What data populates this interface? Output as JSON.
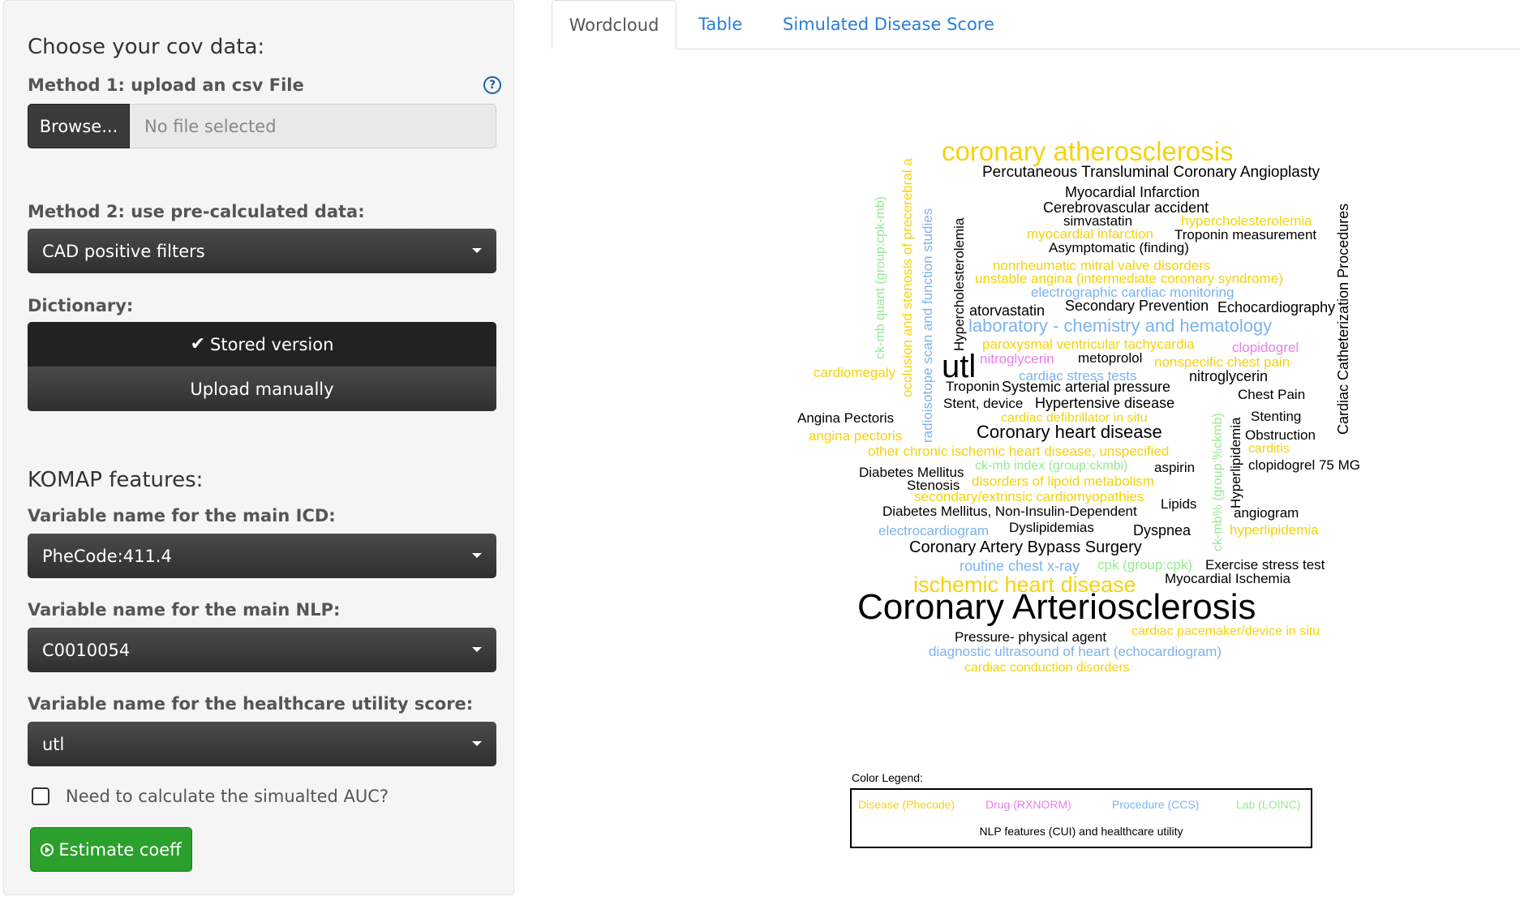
{
  "sidebar": {
    "heading": "Choose your cov data:",
    "method1_label": "Method 1: upload an csv File",
    "browse_label": "Browse...",
    "file_placeholder": "No file selected",
    "method2_label": "Method 2: use pre-calculated data:",
    "method2_value": "CAD positive filters",
    "dictionary_label": "Dictionary:",
    "dict_stored": "Stored version",
    "dict_manual": "Upload manually",
    "komap_heading": "KOMAP features:",
    "icd_label": "Variable name for the main ICD:",
    "icd_value": "PheCode:411.4",
    "nlp_label": "Variable name for the main NLP:",
    "nlp_value": "C0010054",
    "util_label": "Variable name for the healthcare utility score:",
    "util_value": "utl",
    "auc_label": "Need to calculate the simualted AUC?",
    "estimate_label": "Estimate coeff"
  },
  "tabs": [
    "Wordcloud",
    "Table",
    "Simulated Disease Score"
  ],
  "wordcloud": {
    "words": [
      "coronary atherosclerosis",
      "Percutaneous Transluminal Coronary Angioplasty",
      "Myocardial Infarction",
      "Cerebrovascular accident",
      "simvastatin",
      "hypercholesterolemia",
      "myocardial infarction",
      "Troponin measurement",
      "Asymptomatic (finding)",
      "nonrheumatic mitral valve disorders",
      "unstable angina (intermediate coronary syndrome)",
      "electrographic cardiac monitoring",
      "atorvastatin",
      "Secondary Prevention",
      "Echocardiography",
      "laboratory - chemistry and hematology",
      "paroxysmal ventricular tachycardia",
      "clopidogrel",
      "nitroglycerin",
      "metoprolol",
      "nonspecific chest pain",
      "utl",
      "cardiomegaly",
      "cardiac stress tests",
      "nitroglycerin",
      "Troponin",
      "Systemic arterial pressure",
      "Chest Pain",
      "Stent, device",
      "Hypertensive disease",
      "Stenting",
      "Angina Pectoris",
      "cardiac defibrillator in situ",
      "angina pectoris",
      "Coronary heart disease",
      "Obstruction",
      "other chronic ischemic heart disease, unspecified",
      "carditis",
      "Diabetes Mellitus",
      "ck-mb index (group:ckmbi)",
      "aspirin",
      "clopidogrel 75 MG",
      "Stenosis",
      "disorders of lipoid metabolism",
      "secondary/extrinsic cardiomyopathies",
      "Diabetes Mellitus, Non-Insulin-Dependent",
      "Lipids",
      "angiogram",
      "electrocardiogram",
      "Dyslipidemias",
      "Dyspnea",
      "hyperlipidemia",
      "Coronary Artery Bypass Surgery",
      "routine chest x-ray",
      "cpk (group:cpk)",
      "Exercise stress test",
      "ischemic heart disease",
      "Myocardial Ischemia",
      "Coronary Arteriosclerosis",
      "Pressure- physical agent",
      "cardiac pacemaker/device in situ",
      "diagnostic ultrasound of heart (echocardiogram)",
      "cardiac conduction disorders",
      "ck-mb quant (group:cpk-mb)",
      "occlusion and stenosis of precerebral a",
      "radioisotope scan and function studies",
      "Hypercholesterolemia",
      "Hyperlipidemia",
      "ck-mb% (group:%ckmb)",
      "Cardiac Catheterization Procedures"
    ],
    "colors": {
      "disease": "#f6d20c",
      "drug": "#e67fe6",
      "procedure": "#7db3ec",
      "lab": "#94e994",
      "nlp": "#000000"
    }
  },
  "legend": {
    "title": "Color Legend:",
    "disease": "Disease (Phecode)",
    "drug": "Drug (RXNORM)",
    "procedure": "Procedure (CCS)",
    "lab": "Lab (LOINC)",
    "nlp": "NLP features (CUI) and healthcare utility"
  }
}
